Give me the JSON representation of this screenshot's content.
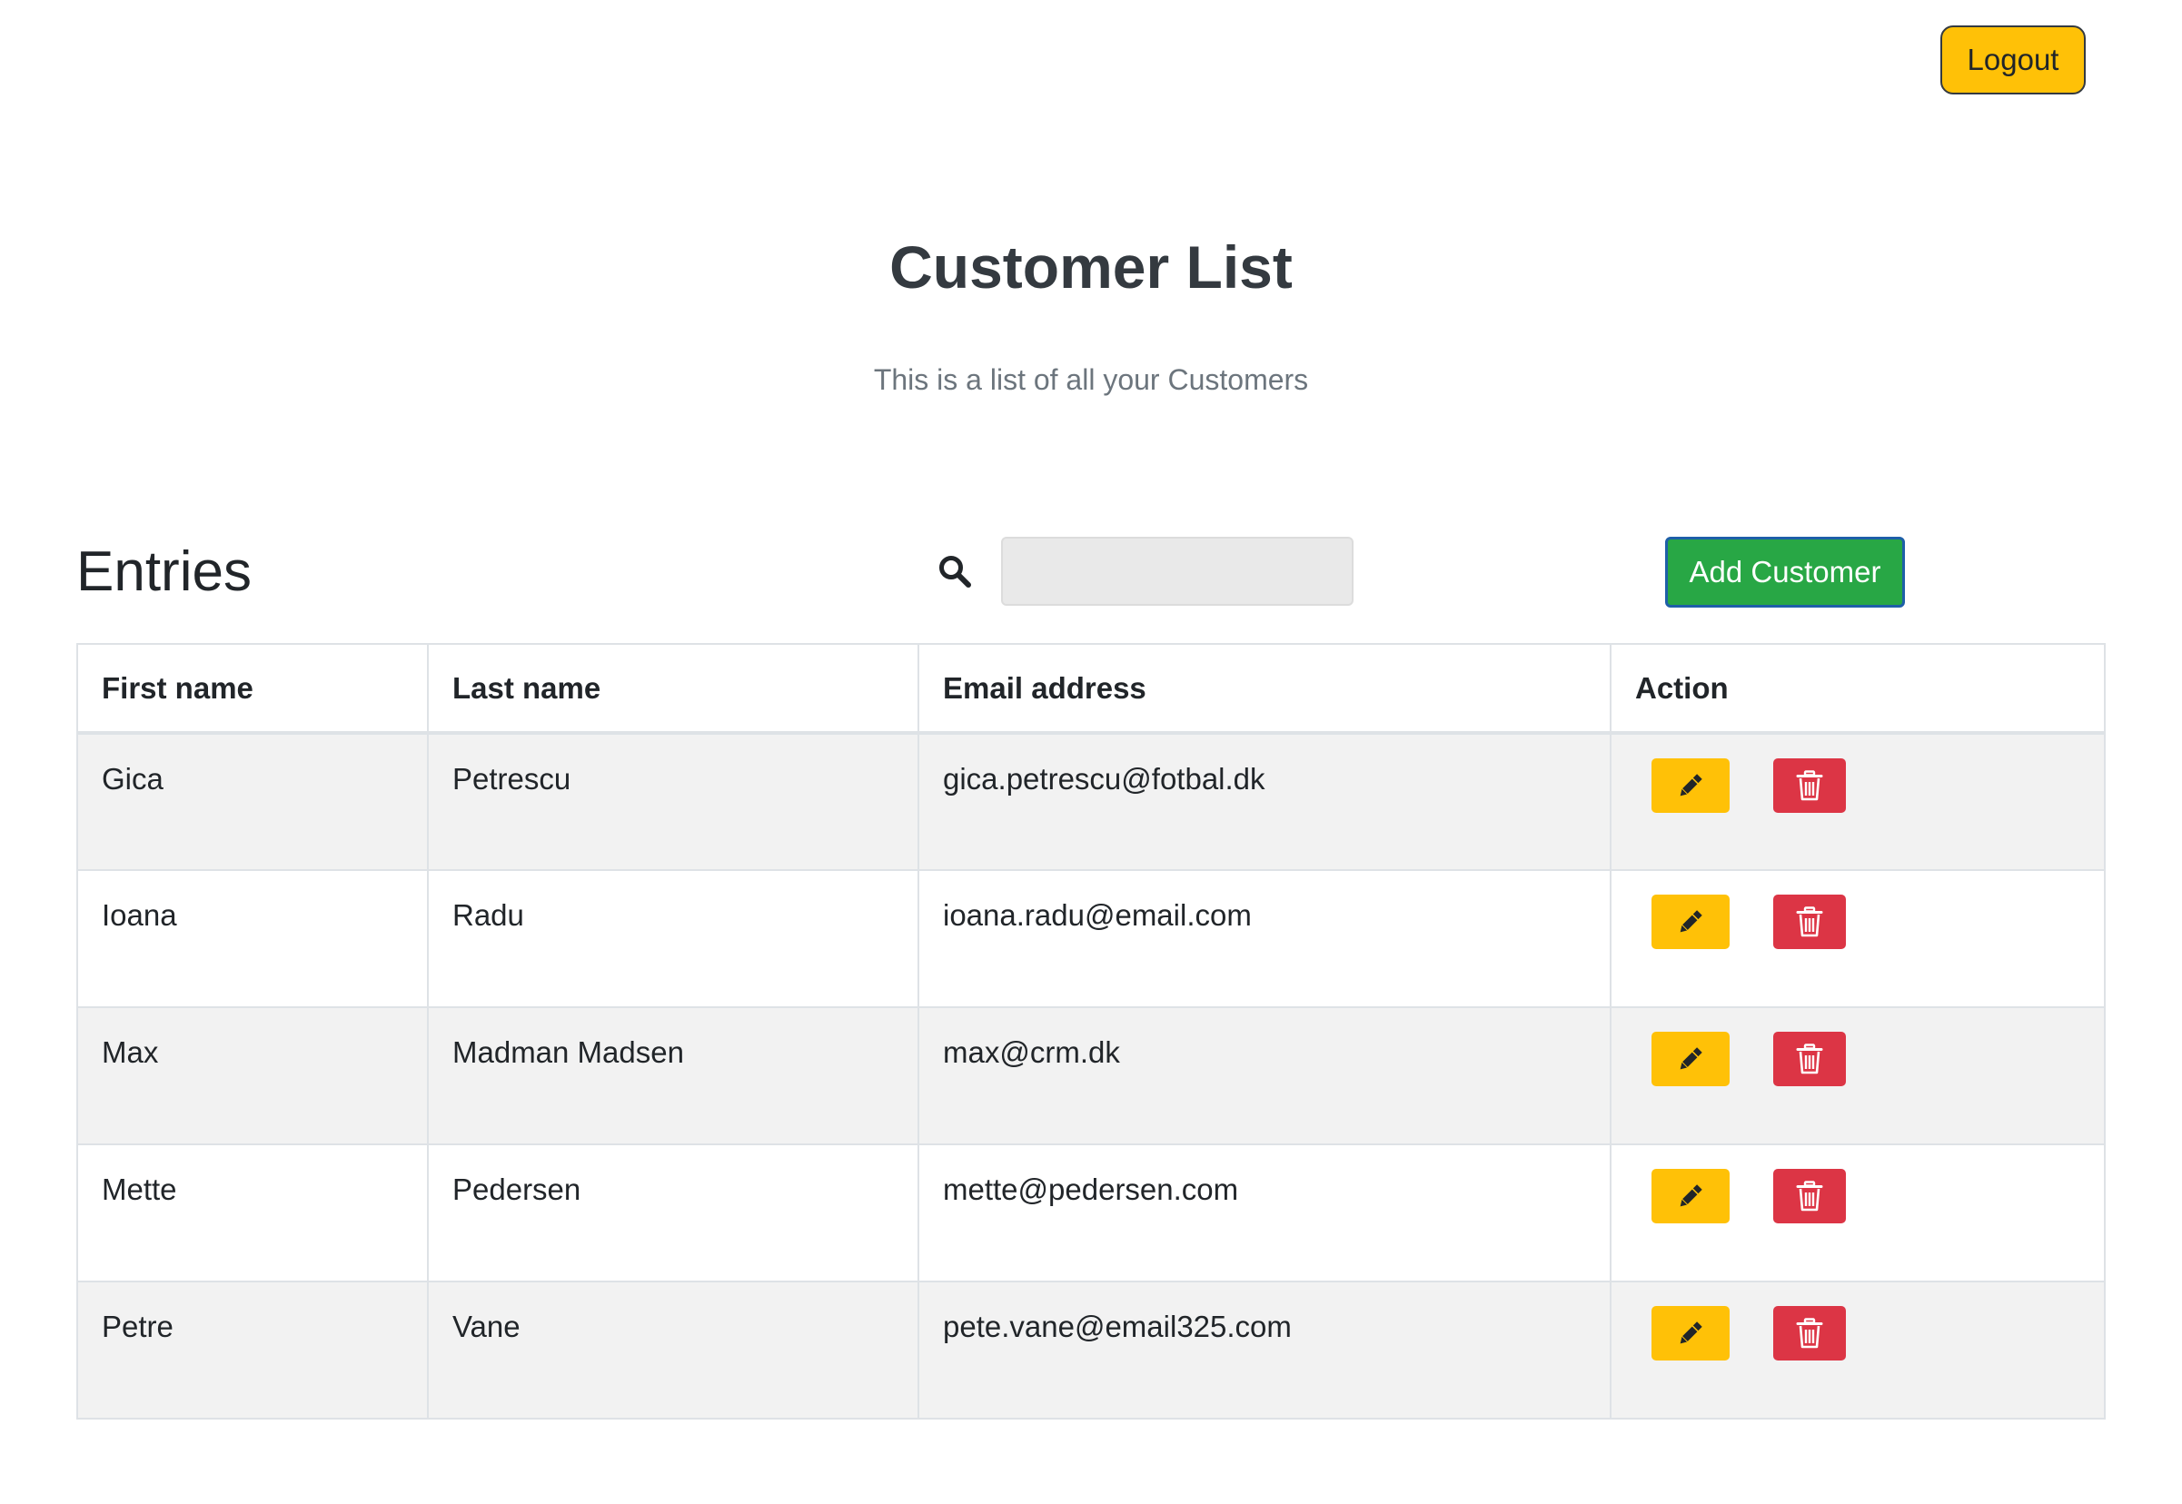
{
  "header": {
    "logout_label": "Logout",
    "title": "Customer List",
    "subtitle": "This is a list of all your Customers"
  },
  "toolbar": {
    "entries_title": "Entries",
    "search_icon": "search-icon",
    "search_placeholder": "",
    "search_value": "",
    "add_label": "Add Customer"
  },
  "table": {
    "columns": [
      "First name",
      "Last name",
      "Email address",
      "Action"
    ],
    "rows": [
      {
        "first": "Gica",
        "last": "Petrescu",
        "email": "gica.petrescu@fotbal.dk"
      },
      {
        "first": "Ioana",
        "last": "Radu",
        "email": "ioana.radu@email.com"
      },
      {
        "first": "Max",
        "last": "Madman Madsen",
        "email": "max@crm.dk"
      },
      {
        "first": "Mette",
        "last": "Pedersen",
        "email": "mette@pedersen.com"
      },
      {
        "first": "Petre",
        "last": "Vane",
        "email": "pete.vane@email325.com"
      }
    ],
    "edit_icon": "pencil-icon",
    "delete_icon": "trash-icon"
  },
  "colors": {
    "logout": "#ffc107",
    "add": "#28a745",
    "edit": "#ffc107",
    "delete": "#dc3545",
    "stripe": "#f2f2f2"
  }
}
